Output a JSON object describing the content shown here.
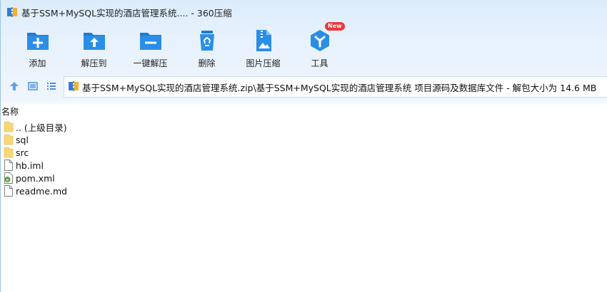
{
  "window": {
    "title": "基于SSM+MySQL实现的酒店管理系统.... - 360压缩"
  },
  "toolbar": {
    "items": [
      {
        "label": "添加",
        "icon": "add-folder-icon"
      },
      {
        "label": "解压到",
        "icon": "extract-to-icon"
      },
      {
        "label": "一键解压",
        "icon": "one-click-extract-icon"
      },
      {
        "label": "删除",
        "icon": "recycle-bin-icon"
      },
      {
        "label": "图片压缩",
        "icon": "image-compress-icon"
      },
      {
        "label": "工具",
        "icon": "tools-icon",
        "badge": "New"
      }
    ]
  },
  "address": {
    "path": "基于SSM+MySQL实现的酒店管理系统.zip\\基于SSM+MySQL实现的酒店管理系统 项目源码及数据库文件 - 解包大小为 14.6 MB"
  },
  "list": {
    "column_name": "名称",
    "items": [
      {
        "name": ".. (上级目录)",
        "type": "folder"
      },
      {
        "name": "sql",
        "type": "folder"
      },
      {
        "name": "src",
        "type": "folder"
      },
      {
        "name": "hb.iml",
        "type": "file"
      },
      {
        "name": "pom.xml",
        "type": "xml"
      },
      {
        "name": "readme.md",
        "type": "file"
      }
    ]
  },
  "colors": {
    "accent": "#2a8ae0",
    "badge": "#e8393b",
    "folder": "#f7d774"
  }
}
